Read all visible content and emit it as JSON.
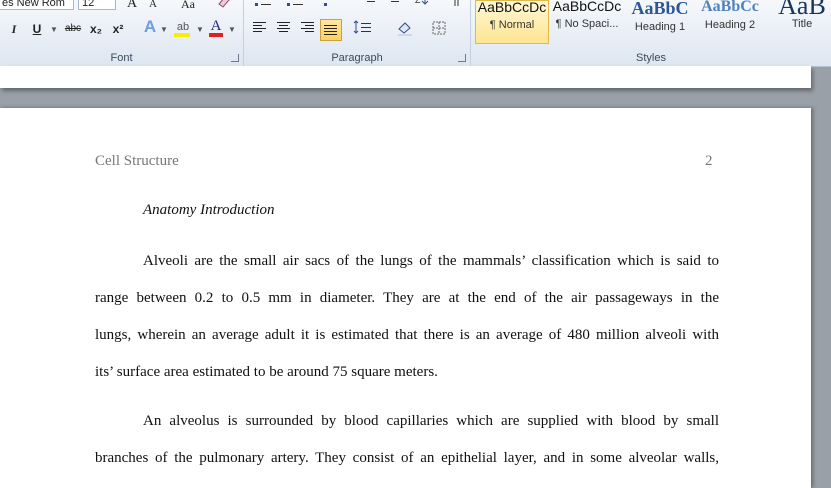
{
  "ribbon": {
    "font_group": {
      "label": "Font",
      "font_name": "es New Rom",
      "font_size": "12",
      "grow_label": "A",
      "shrink_label": "A",
      "change_case_label": "Aa",
      "italic_label": "I",
      "underline_label": "U",
      "strike_label": "abc",
      "subscript_label": "x₂",
      "superscript_label": "x²",
      "effects_label": "A",
      "highlight_label": "ab",
      "font_color_label": "A",
      "highlight_color": "#f5f000",
      "font_color": "#e02020"
    },
    "paragraph_group": {
      "label": "Paragraph"
    },
    "styles_group": {
      "label": "Styles",
      "tiles": [
        {
          "sample": "AaBbCcDc",
          "name": "¶ Normal"
        },
        {
          "sample": "AaBbCcDc",
          "name": "¶ No Spaci..."
        },
        {
          "sample": "AaBbC",
          "name": "Heading 1"
        },
        {
          "sample": "AaBbCc",
          "name": "Heading 2"
        },
        {
          "sample": "AaB",
          "name": "Title"
        }
      ]
    }
  },
  "document": {
    "header_title": "Cell Structure",
    "page_number": "2",
    "section_title": "Anatomy Introduction",
    "paragraph1": [
      "Alveoli are the small air sacs of the lungs of the mammals’ classification which is said to",
      "range between 0.2 to 0.5 mm in diameter. They are at the end of the air passageways in the",
      "lungs, wherein an average adult it is estimated that there is an average of 480 million alveoli with",
      "its’ surface area estimated to be around 75 square meters."
    ],
    "paragraph2": [
      "An alveolus is surrounded by blood capillaries which are supplied with blood by small",
      "branches of the pulmonary artery. They consist of an epithelial layer, and in some alveolar walls,"
    ]
  }
}
